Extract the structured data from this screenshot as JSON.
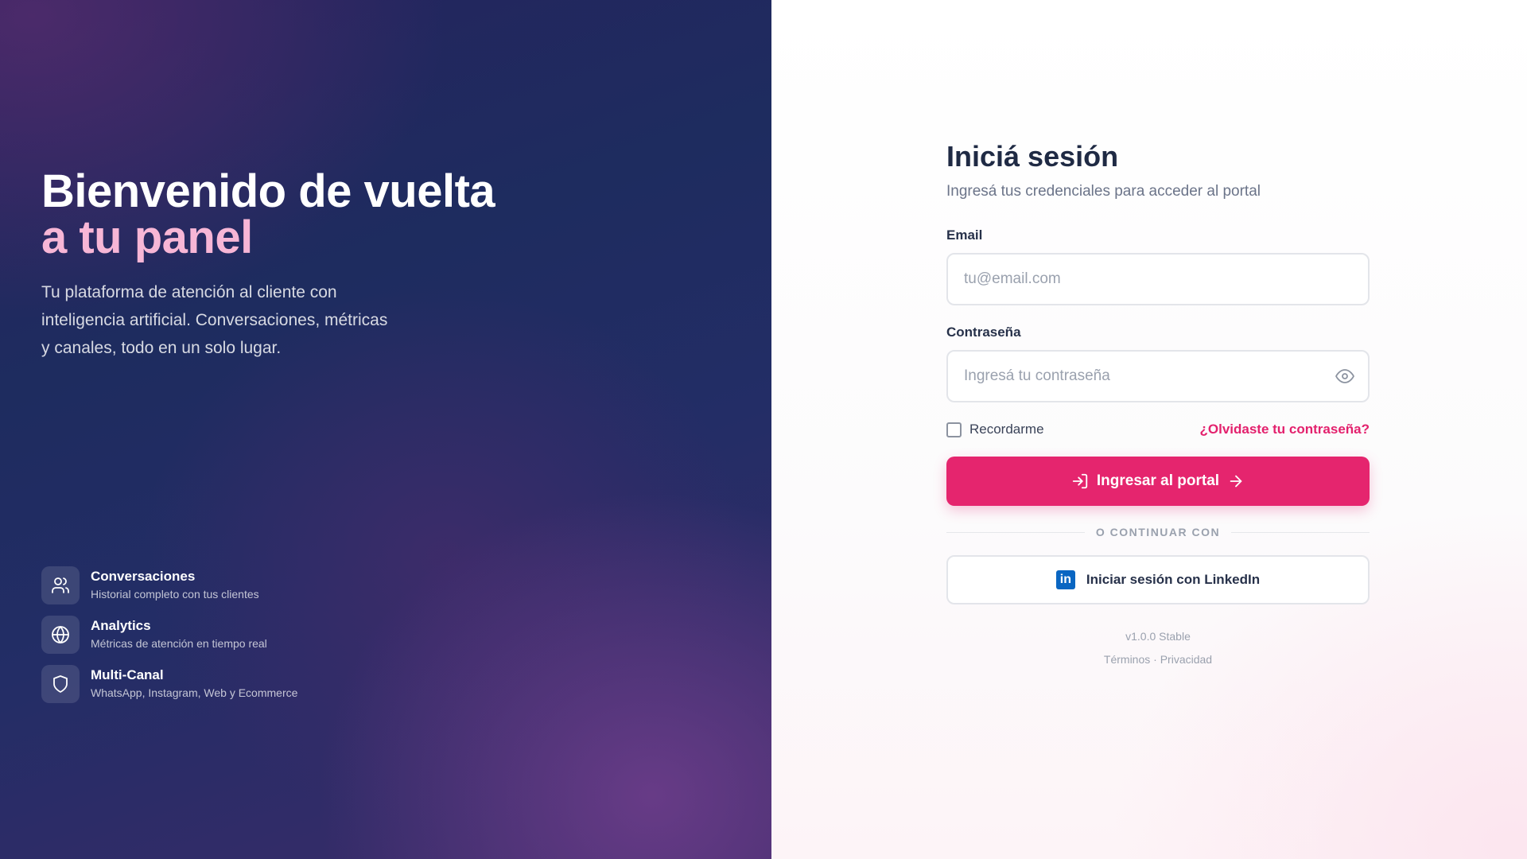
{
  "hero": {
    "title_line1": "Bienvenido de vuelta",
    "title_line2": "a tu panel",
    "description": "Tu plataforma de atención al cliente con inteligencia artificial. Conversaciones, métricas y canales, todo en un solo lugar."
  },
  "features": [
    {
      "icon": "users-icon",
      "title": "Conversaciones",
      "subtitle": "Historial completo con tus clientes"
    },
    {
      "icon": "globe-icon",
      "title": "Analytics",
      "subtitle": "Métricas de atención en tiempo real"
    },
    {
      "icon": "shield-icon",
      "title": "Multi-Canal",
      "subtitle": "WhatsApp, Instagram, Web y Ecommerce"
    }
  ],
  "login": {
    "title": "Iniciá sesión",
    "subtitle": "Ingresá tus credenciales para acceder al portal",
    "email_label": "Email",
    "email_placeholder": "tu@email.com",
    "email_value": "",
    "password_label": "Contraseña",
    "password_placeholder": "Ingresá tu contraseña",
    "password_value": "",
    "remember_label": "Recordarme",
    "remember_checked": false,
    "forgot_label": "¿Olvidaste tu contraseña?",
    "submit_label": "Ingresar al portal",
    "divider_text": "O CONTINUAR CON",
    "linkedin_label": "Iniciar sesión con LinkedIn"
  },
  "footer": {
    "version": "v1.0.0 Stable",
    "terms": "Términos",
    "separator": "·",
    "privacy": "Privacidad"
  },
  "colors": {
    "accent": "#e5256e",
    "hero_highlight": "#f7b6d6",
    "left_bg": "#1e2c5f",
    "linkedin": "#0a66c2"
  }
}
